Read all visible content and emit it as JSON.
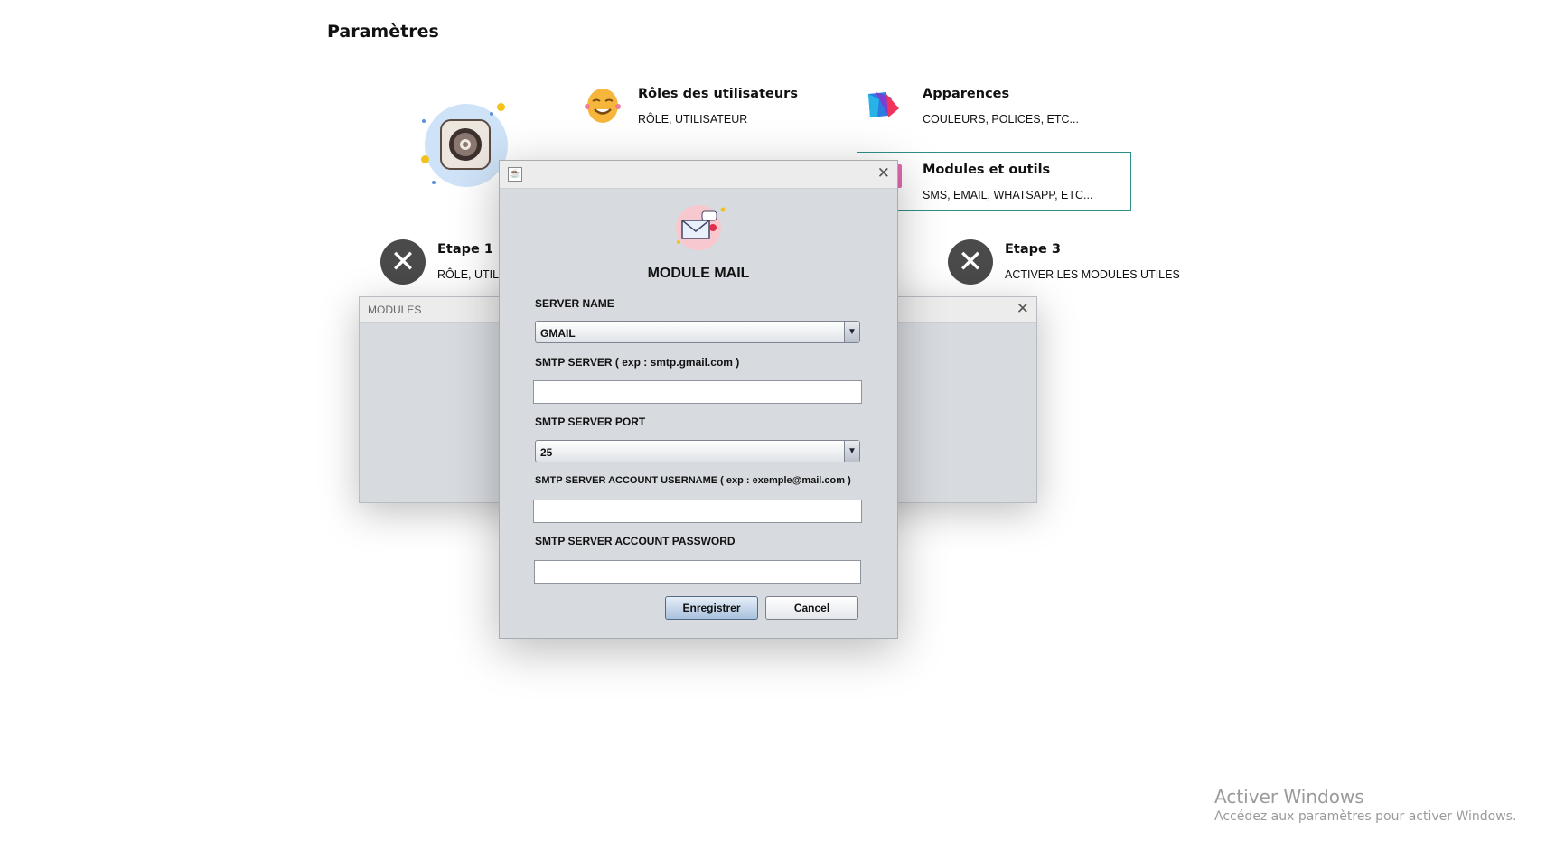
{
  "page": {
    "title": "Paramètres"
  },
  "cards": [
    {
      "title": "Rôles des utilisateurs",
      "subtitle": "RÔLE, UTILISATEUR",
      "icon": "theater-mask-icon"
    },
    {
      "title": "Apparences",
      "subtitle": "COULEURS, POLICES, ETC...",
      "icon": "palette-cube-icon"
    },
    {
      "title": "Modules et outils",
      "subtitle": "SMS, EMAIL, WHATSAPP, ETC...",
      "icon": "tools-icon",
      "selected": true
    }
  ],
  "steps": [
    {
      "title": "Etape 1",
      "subtitle": "RÔLE, UTIL",
      "status_icon": "close-icon"
    },
    {
      "title": "Etape 3",
      "subtitle": "ACTIVER LES MODULES UTILES",
      "status_icon": "close-icon"
    }
  ],
  "modules_window": {
    "title": "MODULES"
  },
  "dialog": {
    "heading": "MODULE MAIL",
    "fields": {
      "server_name_label": "SERVER NAME",
      "server_name_value": "GMAIL",
      "smtp_server_label": "SMTP SERVER ( exp : smtp.gmail.com )",
      "smtp_server_value": "",
      "smtp_port_label": "SMTP SERVER PORT",
      "smtp_port_value": "25",
      "username_label": "SMTP SERVER ACCOUNT USERNAME ( exp : exemple@mail.com )",
      "username_value": "",
      "password_label": "SMTP SERVER ACCOUNT PASSWORD",
      "password_value": ""
    },
    "buttons": {
      "save": "Enregistrer",
      "cancel": "Cancel"
    }
  },
  "watermark": {
    "line1": "Activer Windows",
    "line2": "Accédez aux paramètres pour activer Windows."
  },
  "colors": {
    "accent_border": "#2e8f86",
    "step_fail": "#4a4a4a",
    "hero_bg": "#cfe3f8"
  }
}
